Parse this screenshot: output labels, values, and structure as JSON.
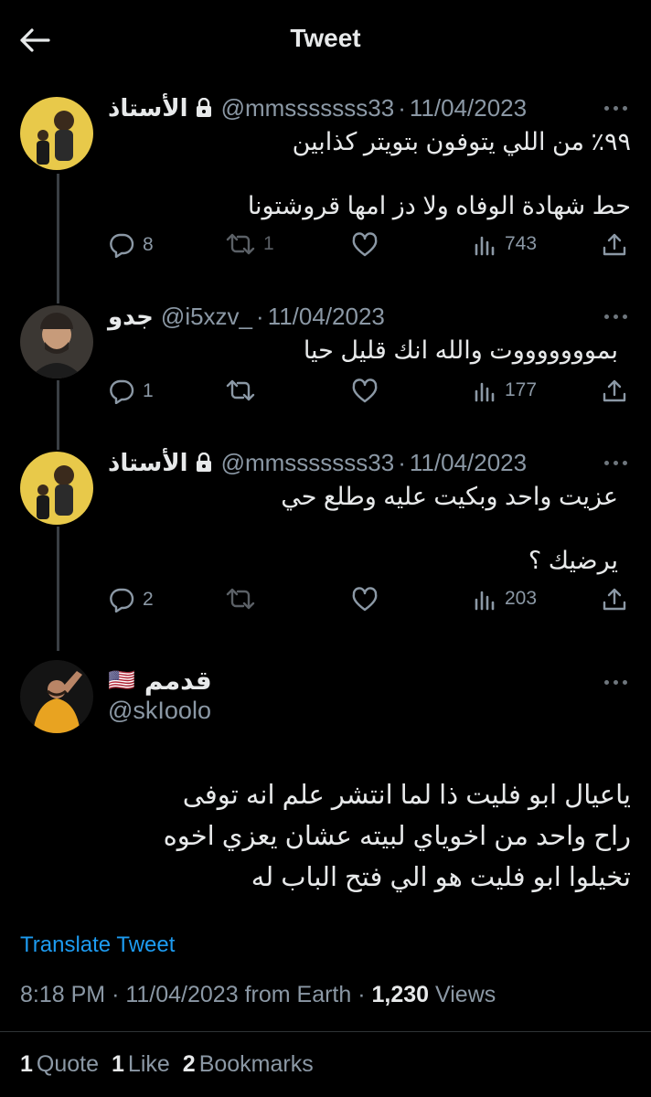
{
  "header": {
    "title": "Tweet"
  },
  "tweets": [
    {
      "name": "الأستاذ",
      "handle": "@mmsssssss33",
      "date": "11/04/2023",
      "lines": [
        "٩٩٪ من اللي يتوفون بتويتر كذابين",
        "حط شهادة الوفاه ولا دز امها قروشتونا"
      ],
      "replies": "8",
      "retweets": "1",
      "views": "743"
    },
    {
      "name": "جدو",
      "handle": "@i5xzv_",
      "date": "11/04/2023",
      "lines": [
        "بموووووووت والله انك قليل حيا"
      ],
      "replies": "1",
      "views": "177"
    },
    {
      "name": "الأستاذ",
      "handle": "@mmsssssss33",
      "date": "11/04/2023",
      "lines": [
        "عزيت واحد وبكيت عليه وطلع حي",
        "يرضيك ؟"
      ],
      "replies": "2",
      "views": "203"
    }
  ],
  "main_tweet": {
    "name": "قدمم",
    "flag": "🇺🇸",
    "handle": "@skIoolo",
    "lines": [
      "ياعيال ابو فليت ذا لما انتشر علم انه توفى",
      "راح واحد من اخوياي لبيته عشان يعزي اخوه",
      "تخيلوا ابو فليت هو الي فتح الباب له"
    ],
    "translate_label": "Translate Tweet",
    "time": "8:18 PM",
    "date": "11/04/2023",
    "source": "from Earth",
    "views_count": "1,230",
    "views_label": "Views",
    "quotes_count": "1",
    "quotes_label": "Quote",
    "likes_count": "1",
    "likes_label": "Like",
    "bookmarks_count": "2",
    "bookmarks_label": "Bookmarks"
  },
  "colors": {
    "background": "#000000",
    "text": "#e7e9ea",
    "muted": "#8b98a5",
    "accent": "#1d9bf0"
  }
}
